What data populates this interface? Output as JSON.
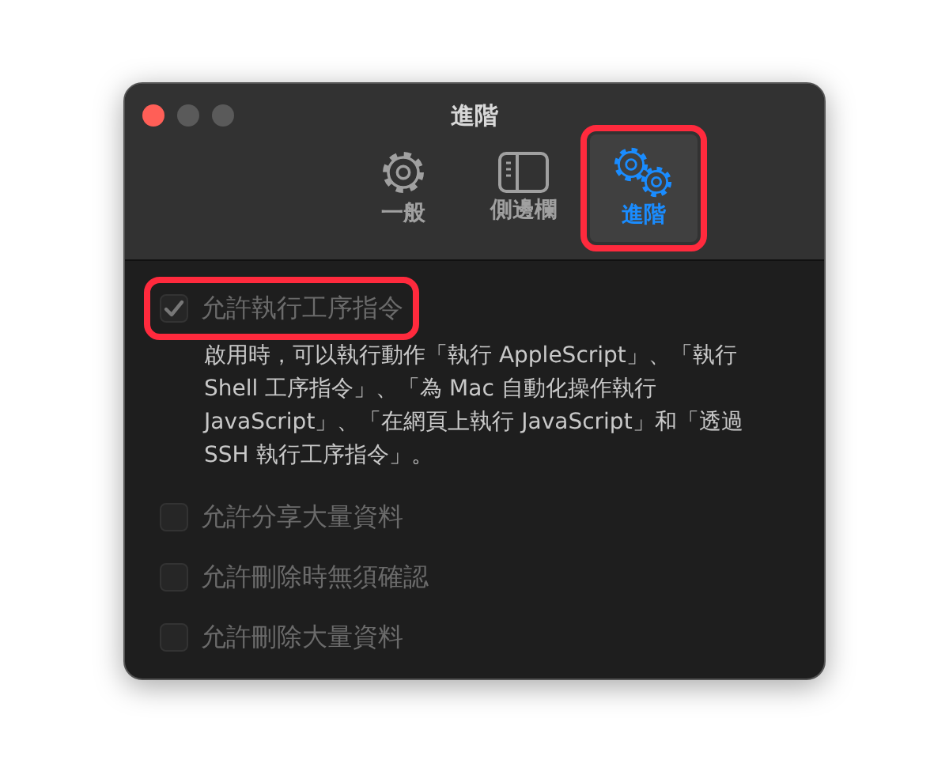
{
  "window": {
    "title": "進階"
  },
  "tabs": [
    {
      "label": "一般",
      "kind": "gear",
      "selected": false,
      "highlighted": false
    },
    {
      "label": "側邊欄",
      "kind": "sidebar",
      "selected": false,
      "highlighted": false
    },
    {
      "label": "進階",
      "kind": "gears",
      "selected": true,
      "highlighted": true
    }
  ],
  "options": [
    {
      "label": "允許執行工序指令",
      "checked": true,
      "disabled": true,
      "highlighted": true,
      "description": "啟用時，可以執行動作「執行 AppleScript」、「執行 Shell 工序指令」、「為 Mac 自動化操作執行 JavaScript」、「在網頁上執行 JavaScript」和「透過 SSH 執行工序指令」。"
    },
    {
      "label": "允許分享大量資料",
      "checked": false,
      "disabled": true,
      "highlighted": false
    },
    {
      "label": "允許刪除時無須確認",
      "checked": false,
      "disabled": true,
      "highlighted": false
    },
    {
      "label": "允許刪除大量資料",
      "checked": false,
      "disabled": true,
      "highlighted": false
    }
  ]
}
